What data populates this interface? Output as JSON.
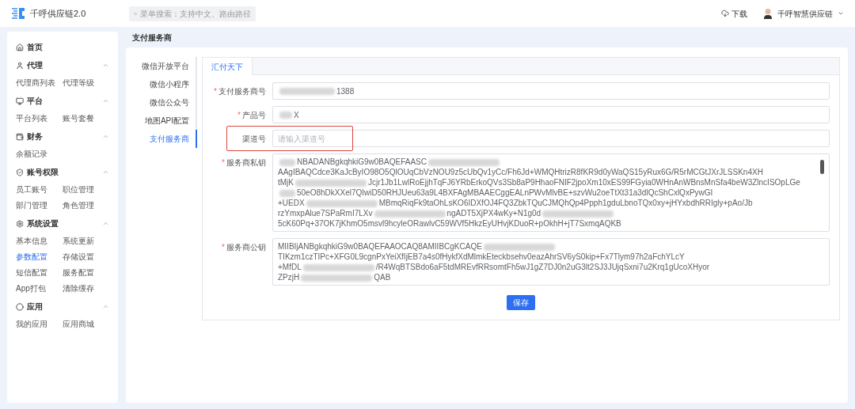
{
  "header": {
    "logo_text": "千呼供应链2.0",
    "search": {
      "placeholder": "菜单搜索：支持中文、路由路径"
    },
    "download": "下载",
    "user": "千呼智慧供应链"
  },
  "sidebar": {
    "groups": [
      {
        "title": "首页"
      },
      {
        "title": "代理",
        "expanded": true,
        "items": [
          {
            "label": "代理商列表",
            "selected": false
          },
          {
            "label": "代理等级",
            "selected": false
          }
        ]
      },
      {
        "title": "平台",
        "expanded": true,
        "items": [
          {
            "label": "平台列表",
            "selected": false
          },
          {
            "label": "账号套餐",
            "selected": false
          }
        ]
      },
      {
        "title": "财务",
        "expanded": true,
        "items": [
          {
            "label": "余额记录",
            "selected": false
          }
        ]
      },
      {
        "title": "账号权限",
        "expanded": true,
        "items": [
          {
            "label": "员工账号",
            "selected": false
          },
          {
            "label": "职位管理",
            "selected": false
          },
          {
            "label": "部门管理",
            "selected": false
          },
          {
            "label": "角色管理",
            "selected": false
          }
        ]
      },
      {
        "title": "系统设置",
        "expanded": true,
        "items": [
          {
            "label": "基本信息",
            "selected": false
          },
          {
            "label": "系统更新",
            "selected": false
          },
          {
            "label": "参数配置",
            "selected": true
          },
          {
            "label": "存储设置",
            "selected": false
          },
          {
            "label": "短信配置",
            "selected": false
          },
          {
            "label": "服务配置",
            "selected": false
          },
          {
            "label": "App打包",
            "selected": false
          },
          {
            "label": "清除缓存",
            "selected": false
          }
        ]
      },
      {
        "title": "应用",
        "expanded": true,
        "items": [
          {
            "label": "我的应用",
            "selected": false
          },
          {
            "label": "应用商城",
            "selected": false
          }
        ]
      }
    ]
  },
  "page_title": "支付服务商",
  "subnav": [
    {
      "label": "微信开放平台",
      "selected": false
    },
    {
      "label": "微信小程序",
      "selected": false
    },
    {
      "label": "微信公众号",
      "selected": false
    },
    {
      "label": "地图API配置",
      "selected": false
    },
    {
      "label": "支付服务商",
      "selected": true
    }
  ],
  "tabs": [
    {
      "label": "汇付天下",
      "selected": true
    }
  ],
  "form": {
    "fields": [
      {
        "kind": "input",
        "required_mark": "*",
        "label": "支付服务商号",
        "value": "1388",
        "redacted_prefix": true
      },
      {
        "kind": "input",
        "required_mark": "*",
        "label": "产品号",
        "value": "X",
        "redacted_prefix": true
      },
      {
        "kind": "input",
        "label": "渠道号",
        "placeholder": "请输入渠道号",
        "highlighted": true
      },
      {
        "kind": "textarea",
        "required_mark": "*",
        "label": "服务商私钥",
        "scrollbar": true,
        "lines": [
          [
            {
              "kind": "redacted"
            },
            {
              "kind": "text",
              "text": "NBADANBgkqhkiG9w0BAQEFAASC"
            },
            {
              "kind": "redacted"
            },
            {
              "kind": "text",
              "text": "AAgIBAQCdce3KaJcByIO98O5QlOUqCbVzNOU9z5cUbQv1yCc/Fh6Jd+WMQHtrizR8fKR9d0yWaQS15yRux6G/R5rMCGtJXrJLSSKn4XH"
            }
          ],
          [
            {
              "kind": "text",
              "text": "tMjK"
            },
            {
              "kind": "redacted"
            },
            {
              "kind": "text",
              "text": "Jcjr1Jb1LwlRoEjjhTqFJ6YRbErkoQVs3Sb8aP9HhaoFNIF2jpoXm10xES99FGyia0WHnAnWBnsMnSfa4beW3ZlncISOpLGe"
            }
          ],
          [
            {
              "kind": "redacted"
            },
            {
              "kind": "text",
              "text": "50eO8hDkXXel7QIwiD50RHJUeu63a9L4BXFAgMBAAECggEALnPWvMlvBE+szvWu2oeTtXt31a3dlQcShCxlQxPywGI"
            }
          ],
          [
            {
              "kind": "text",
              "text": "+UEDX"
            },
            {
              "kind": "redacted"
            },
            {
              "kind": "text",
              "text": "MBmqRiqFk9taOhLsKO6IDXfOJ4FQ3ZbkTQuCJMQhQp4Ppph1gduLbnoTQx0xy+jHYxbdhRRIgly+pAo/Jb"
            }
          ],
          [
            {
              "kind": "text",
              "text": "rzYmxpAlue7SPaRmI7LXv"
            },
            {
              "kind": "redacted"
            },
            {
              "kind": "text",
              "text": "ngADT5XjPX4wKy+N1g0d"
            },
            {
              "kind": "redacted"
            },
            {
              "kind": "text",
              "text": "5cK60Pq+37OK7jKhmO5msvl9hcyleORawlvC59WVf5HkzEyUHvjKDuoR+pOkhH+jT7SxmqAQKB"
            }
          ]
        ]
      },
      {
        "kind": "textarea",
        "required_mark": "*",
        "label": "服务商公钥",
        "lines": [
          [
            {
              "kind": "text",
              "text": "MIIBIjANBgkqhkiG9w0BAQEFAAOCAQ8AMIIBCgKCAQE"
            },
            {
              "kind": "redacted"
            },
            {
              "kind": "text",
              "text": "TIKzm1czTIPc+XFG0L9cgnPxYeiXfIjEB7a4s0fHykfXdMlmkEteckbsehv0eazAhrSV6yS0kip+Fx7Tlym97h2aFchYLcY"
            }
          ],
          [
            {
              "kind": "text",
              "text": "+MfDL"
            },
            {
              "kind": "redacted"
            },
            {
              "kind": "text",
              "text": "/R4WqBTSBdo6aF5tdMREvfRRsomtFh5wJ1gZ7DJ0n2uG3lt2SJ3JUjqSxni7u2Krq1gUcoXHyor"
            }
          ],
          [
            {
              "kind": "text",
              "text": "ZPzjH"
            },
            {
              "kind": "redacted"
            },
            {
              "kind": "text",
              "text": "QAB"
            }
          ]
        ]
      }
    ],
    "save_button": "保存"
  }
}
